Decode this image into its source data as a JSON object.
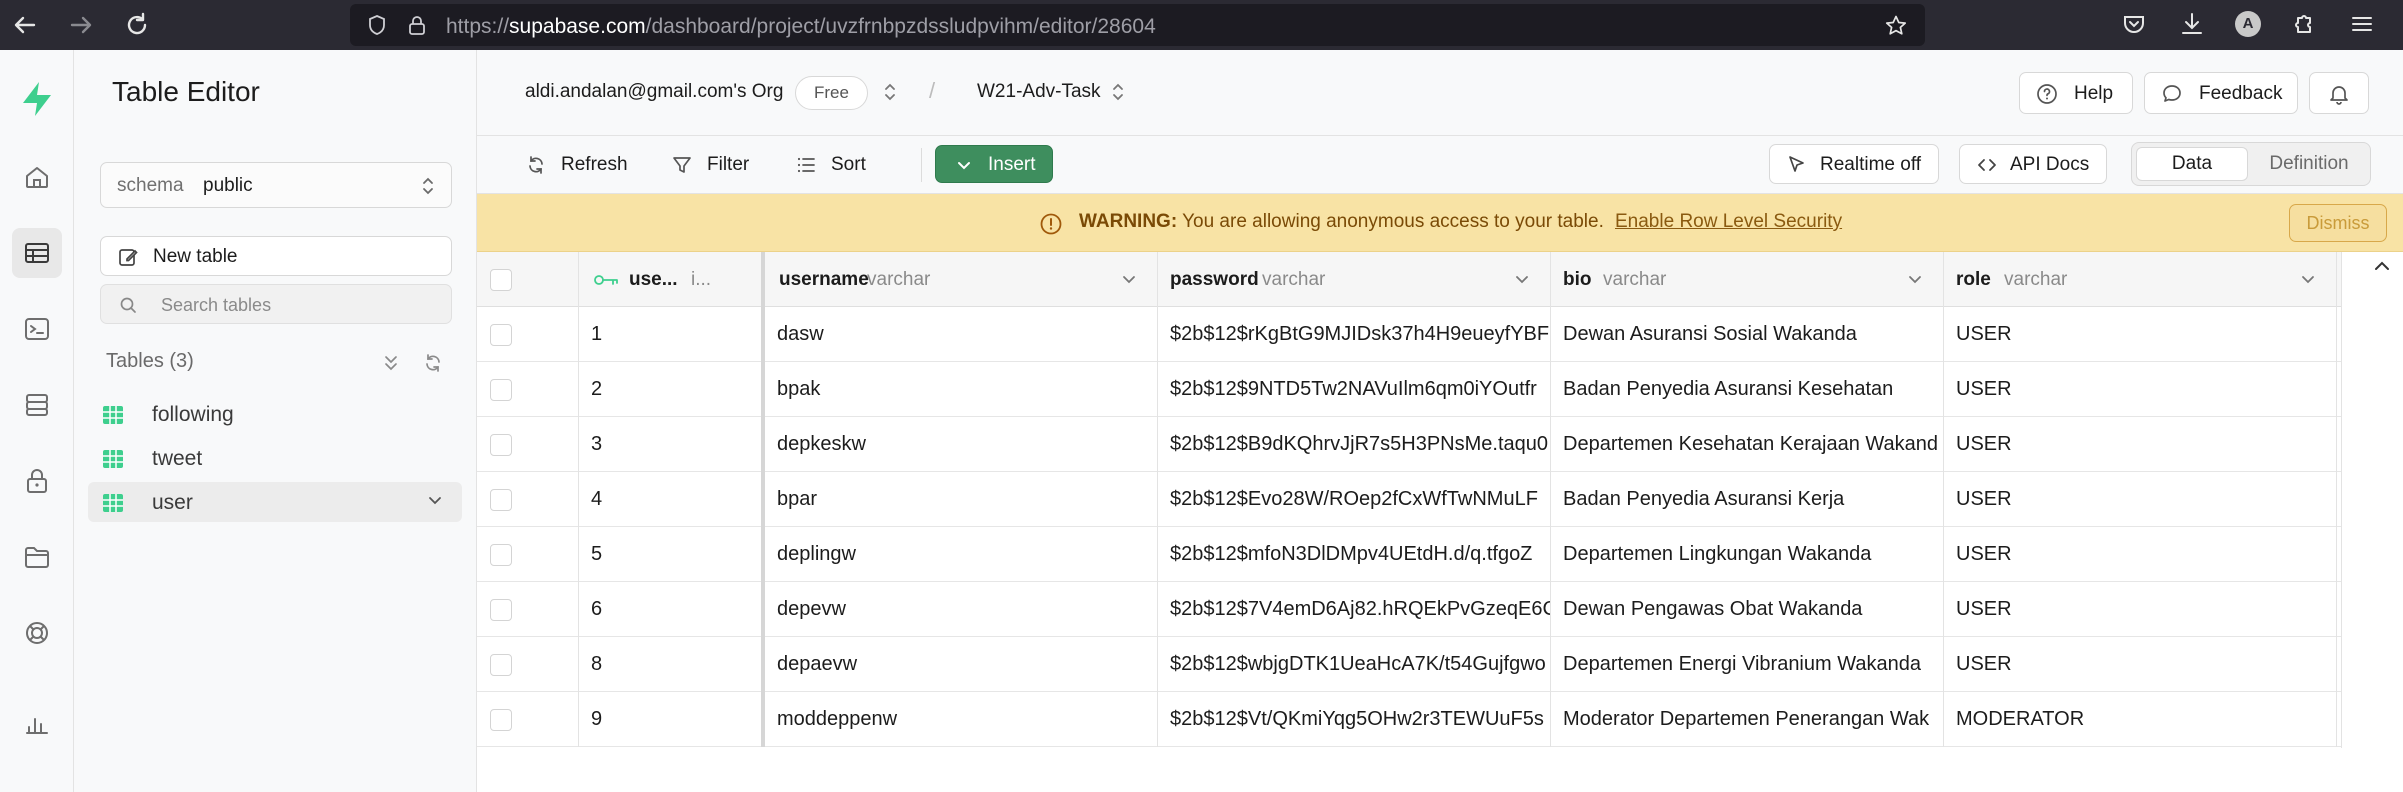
{
  "browser": {
    "url_prefix": "https://",
    "url_domain": "supabase.com",
    "url_path": "/dashboard/project/uvzfrnbpzdssludpvihm/editor/28604",
    "profile_initial": "A"
  },
  "sidebar": {
    "title": "Table Editor",
    "schema_label": "schema",
    "schema_value": "public",
    "new_table_label": "New table",
    "search_placeholder": "Search tables",
    "tables_header": "Tables (3)",
    "tables": [
      {
        "name": "following"
      },
      {
        "name": "tweet"
      },
      {
        "name": "user"
      }
    ]
  },
  "header": {
    "org": "aldi.andalan@gmail.com's Org",
    "plan_badge": "Free",
    "separator": "/",
    "project": "W21-Adv-Task",
    "help_label": "Help",
    "feedback_label": "Feedback"
  },
  "toolbar": {
    "refresh_label": "Refresh",
    "filter_label": "Filter",
    "sort_label": "Sort",
    "insert_label": "Insert",
    "realtime_label": "Realtime off",
    "api_docs_label": "API Docs",
    "view_data_label": "Data",
    "view_definition_label": "Definition"
  },
  "warning": {
    "strong": "WARNING:",
    "text": " You are allowing anonymous access to your table.",
    "link": "Enable Row Level Security",
    "dismiss": "Dismiss"
  },
  "grid": {
    "columns": [
      {
        "name": "use...",
        "type": "i..."
      },
      {
        "name": "username",
        "type": "varchar"
      },
      {
        "name": "password",
        "type": "varchar"
      },
      {
        "name": "bio",
        "type": "varchar"
      },
      {
        "name": "role",
        "type": "varchar"
      }
    ],
    "rows": [
      {
        "id": "1",
        "username": "dasw",
        "password": "$2b$12$rKgBtG9MJIDsk37h4H9eueyfYBF",
        "bio": "Dewan Asuransi Sosial Wakanda",
        "role": "USER"
      },
      {
        "id": "2",
        "username": "bpak",
        "password": "$2b$12$9NTD5Tw2NAVuIlm6qm0iYOutfr",
        "bio": "Badan Penyedia Asuransi Kesehatan",
        "role": "USER"
      },
      {
        "id": "3",
        "username": "depkeskw",
        "password": "$2b$12$B9dKQhrvJjR7s5H3PNsMe.taqu0",
        "bio": "Departemen Kesehatan Kerajaan Wakand",
        "role": "USER"
      },
      {
        "id": "4",
        "username": "bpar",
        "password": "$2b$12$Evo28W/ROep2fCxWfTwNMuLF",
        "bio": "Badan Penyedia Asuransi Kerja",
        "role": "USER"
      },
      {
        "id": "5",
        "username": "deplingw",
        "password": "$2b$12$mfoN3DlDMpv4UEtdH.d/q.tfgoZ",
        "bio": "Departemen Lingkungan Wakanda",
        "role": "USER"
      },
      {
        "id": "6",
        "username": "depevw",
        "password": "$2b$12$7V4emD6Aj82.hRQEkPvGzeqE6C",
        "bio": "Dewan Pengawas Obat Wakanda",
        "role": "USER"
      },
      {
        "id": "8",
        "username": "depaevw",
        "password": "$2b$12$wbjgDTK1UeaHcA7K/t54Gujfgwo",
        "bio": "Departemen Energi Vibranium Wakanda",
        "role": "USER"
      },
      {
        "id": "9",
        "username": "moddeppenw",
        "password": "$2b$12$Vt/QKmiYqg5OHw2r3TEWUuF5s",
        "bio": "Moderator Departemen Penerangan Wak",
        "role": "MODERATOR"
      }
    ]
  },
  "colors": {
    "brand_green": "#3ecf8e",
    "insert_green": "#3e8e5e",
    "warning_bg": "#f8e3a5"
  }
}
